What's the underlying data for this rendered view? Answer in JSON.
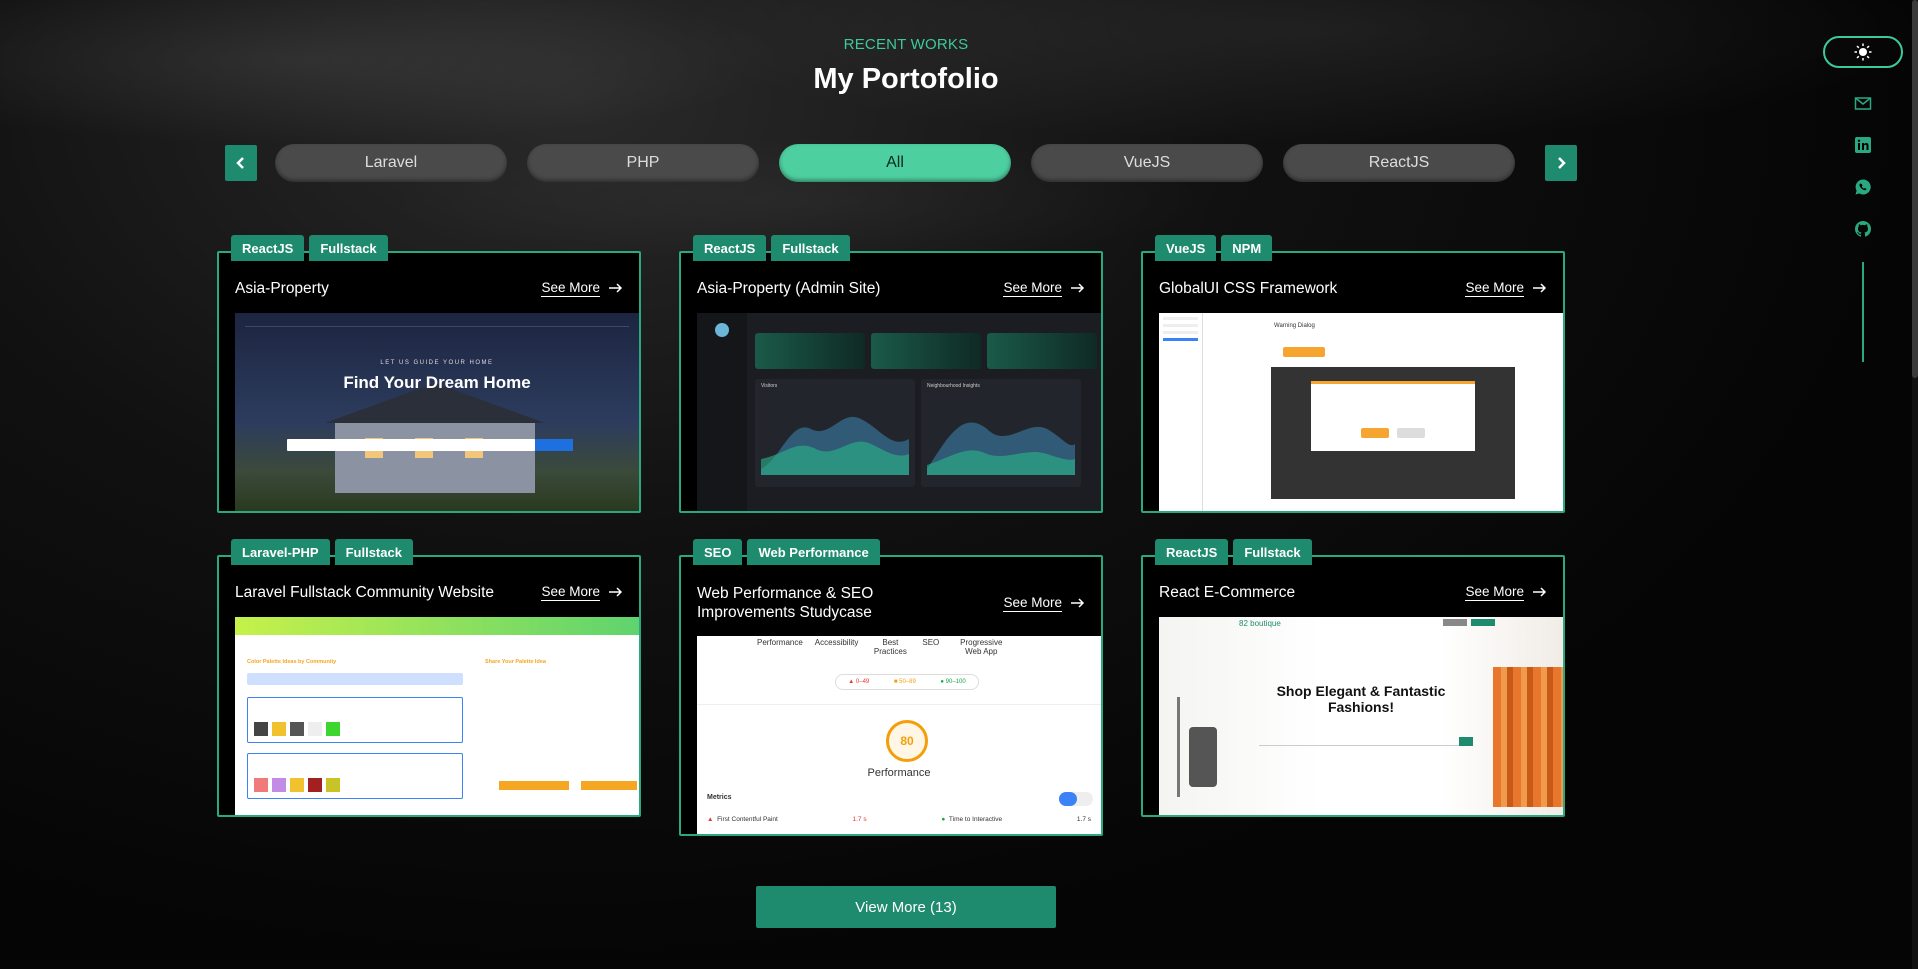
{
  "header": {
    "eyebrow": "RECENT WORKS",
    "title": "My Portofolio"
  },
  "filters": {
    "items": [
      "Laravel",
      "PHP",
      "All",
      "VueJS",
      "ReactJS"
    ],
    "active": "All"
  },
  "cards": [
    {
      "title": "Asia-Property",
      "tags": [
        "ReactJS",
        "Fullstack"
      ],
      "see_more": "See More",
      "thumb": {
        "hero_small": "LET US GUIDE YOUR HOME",
        "hero": "Find Your Dream Home"
      }
    },
    {
      "title": "Asia-Property (Admin Site)",
      "tags": [
        "ReactJS",
        "Fullstack"
      ],
      "see_more": "See More",
      "thumb": {
        "chart_a": "Visitors",
        "chart_b": "Neighbourhood Insights"
      }
    },
    {
      "title": "GlobalUI CSS Framework",
      "tags": [
        "VueJS",
        "NPM"
      ],
      "see_more": "See More",
      "thumb": {
        "heading": "Warning Dialog"
      }
    },
    {
      "title": "Laravel Fullstack Community Website",
      "tags": [
        "Laravel-PHP",
        "Fullstack"
      ],
      "see_more": "See More",
      "thumb": {
        "left": "Color Palette Ideas by Community",
        "right": "Share Your Palette Idea"
      }
    },
    {
      "title": "Web Performance & SEO Improvements Studycase",
      "tags": [
        "SEO",
        "Web Performance"
      ],
      "see_more": "See More",
      "thumb": {
        "tabs": [
          "Performance",
          "Accessibility",
          "Best Practices",
          "SEO",
          "Progressive Web App"
        ],
        "legend": [
          "0–49",
          "50–89",
          "90–100"
        ],
        "score": "80",
        "score_label": "Performance",
        "metrics": "Metrics",
        "m1": "First Contentful Paint",
        "m1v": "1.7 s",
        "m2": "Time to Interactive",
        "m2v": "1.7 s"
      }
    },
    {
      "title": "React E-Commerce",
      "tags": [
        "ReactJS",
        "Fullstack"
      ],
      "see_more": "See More",
      "thumb": {
        "brand": "82 boutique",
        "hero": "Shop Elegant & Fantastic Fashions!"
      }
    }
  ],
  "view_more": "View More (13)",
  "colors": {
    "accent": "#1f8b6e",
    "accent_light": "#4ecfa0",
    "border": "#2aa980"
  },
  "side_icons": [
    "sun-icon",
    "mail-icon",
    "linkedin-icon",
    "whatsapp-icon",
    "github-icon"
  ]
}
